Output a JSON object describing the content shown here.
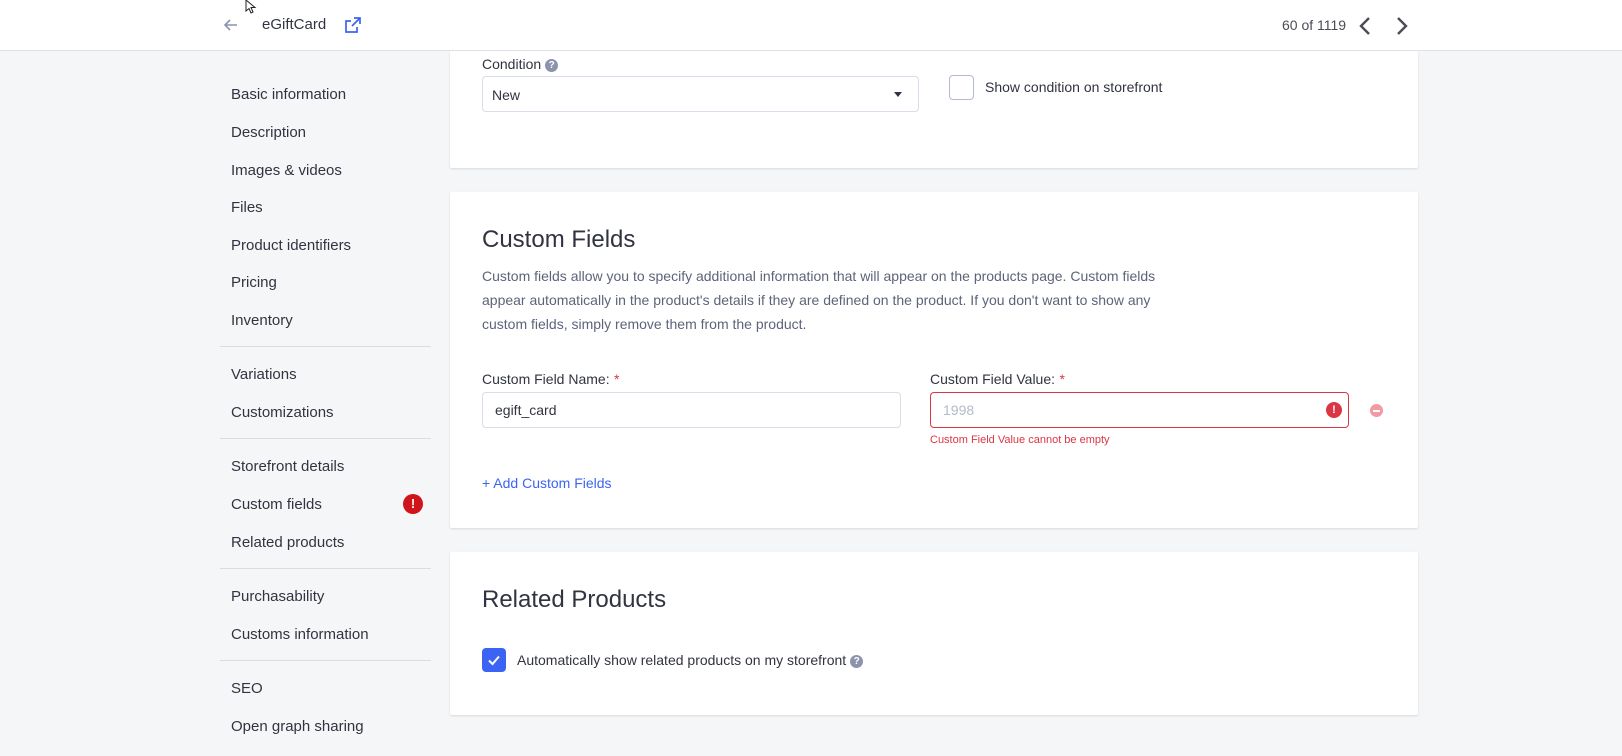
{
  "header": {
    "title": "eGiftCard",
    "pager": "60 of 1119"
  },
  "sidebar": {
    "groups": [
      [
        "Basic information",
        "Description",
        "Images & videos",
        "Files",
        "Product identifiers",
        "Pricing",
        "Inventory"
      ],
      [
        "Variations",
        "Customizations"
      ],
      [
        "Storefront details",
        "Custom fields",
        "Related products"
      ],
      [
        "Purchasability",
        "Customs information"
      ],
      [
        "SEO",
        "Open graph sharing"
      ]
    ],
    "error_badge": "!"
  },
  "condition": {
    "label": "Condition",
    "help": "?",
    "selected": "New",
    "show_on_storefront_label": "Show condition on storefront",
    "show_on_storefront_checked": false
  },
  "custom_fields": {
    "title": "Custom Fields",
    "description": "Custom fields allow you to specify additional information that will appear on the products page. Custom fields appear automatically in the product's details if they are defined on the product. If you don't want to show any custom fields, simply remove them from the product.",
    "name_label": "Custom Field Name:",
    "value_label": "Custom Field Value:",
    "required_mark": "*",
    "name_value": "egift_card",
    "value_value": "",
    "value_placeholder": "1998",
    "error_icon": "!",
    "error_message": "Custom Field Value cannot be empty",
    "add_link": "+ Add Custom Fields"
  },
  "related_products": {
    "title": "Related Products",
    "auto_show_label": "Automatically show related products on my storefront",
    "auto_show_checked": true,
    "help": "?"
  },
  "colors": {
    "accent": "#3c64f4",
    "error": "#db3643",
    "badge": "#d0141b"
  }
}
